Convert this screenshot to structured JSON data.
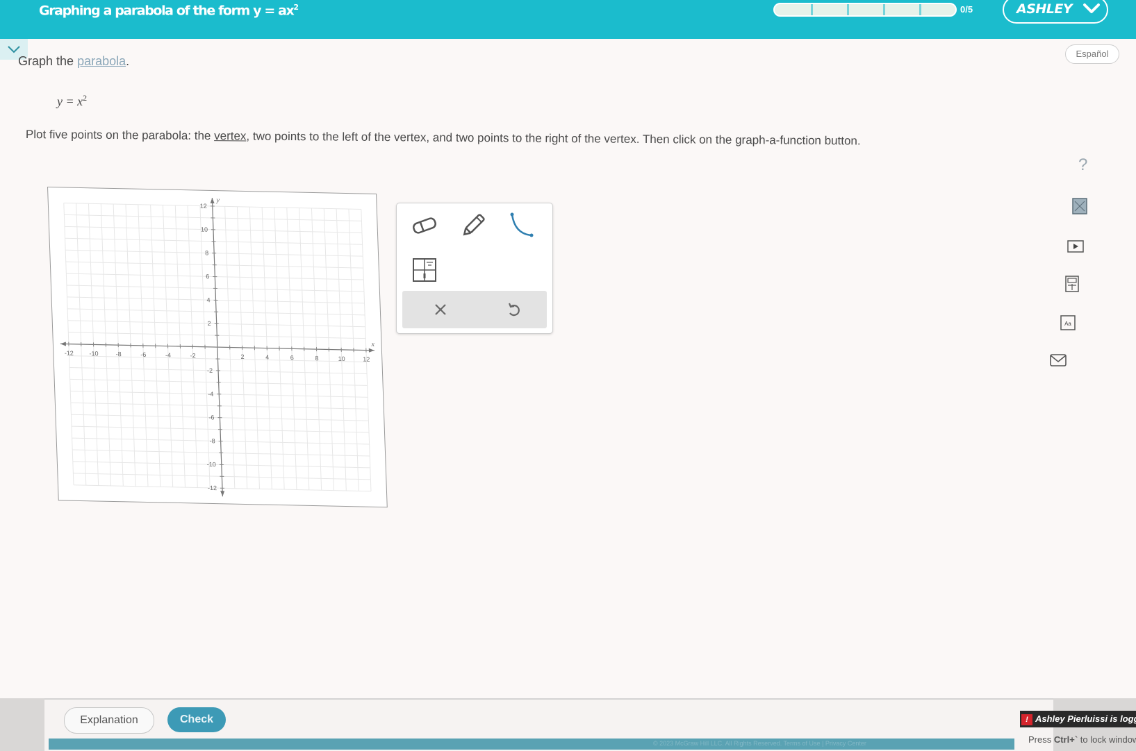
{
  "header": {
    "title_text": "Graphing a parabola of the form y = ax",
    "title_exponent": "2",
    "progress_count": "0/5",
    "progress_fraction": 0,
    "progress_segments": 5,
    "user_name": "ASHLEY",
    "accent_color": "#1bbccd"
  },
  "question": {
    "instruction_prefix": "Graph the ",
    "instruction_link": "parabola",
    "instruction_suffix": ".",
    "equation_lhs": "y",
    "equation_eq": " = ",
    "equation_rhs": "x",
    "equation_exponent": "2",
    "directions_part1": "Plot five points on the parabola: the ",
    "directions_link": "vertex",
    "directions_part2": ", two points to the left of the vertex, and two points to the right of the vertex. Then click on the graph-a-function button."
  },
  "language_button": "Español",
  "graph": {
    "x_axis_label": "x",
    "y_axis_label": "y",
    "x_min": -12,
    "x_max": 12,
    "y_min": -12,
    "y_max": 12,
    "tick_step": 2,
    "grid": true
  },
  "tools": [
    {
      "name": "eraser-tool",
      "icon": "eraser-icon"
    },
    {
      "name": "pencil-tool",
      "icon": "pencil-icon"
    },
    {
      "name": "parabola-tool",
      "icon": "parabola-curve-icon"
    },
    {
      "name": "graph-a-function-tool",
      "icon": "graph-function-icon"
    }
  ],
  "palette_footer": {
    "clear_icon": "close-icon",
    "undo_icon": "undo-icon"
  },
  "right_rail": {
    "help_symbol": "?",
    "icons": [
      "textbook-icon",
      "video-icon",
      "calculator-icon",
      "glossary-icon",
      "message-icon"
    ]
  },
  "footer": {
    "explanation_label": "Explanation",
    "check_label": "Check",
    "copyright_text": "© 2023 McGraw Hill LLC. All Rights Reserved.   Terms of Use   |   Privacy Center",
    "login_notice": "Ashley Pierluissi is logged in",
    "lock_hint_prefix": "Press ",
    "lock_hint_key": "Ctrl+`",
    "lock_hint_suffix": " to lock window"
  }
}
